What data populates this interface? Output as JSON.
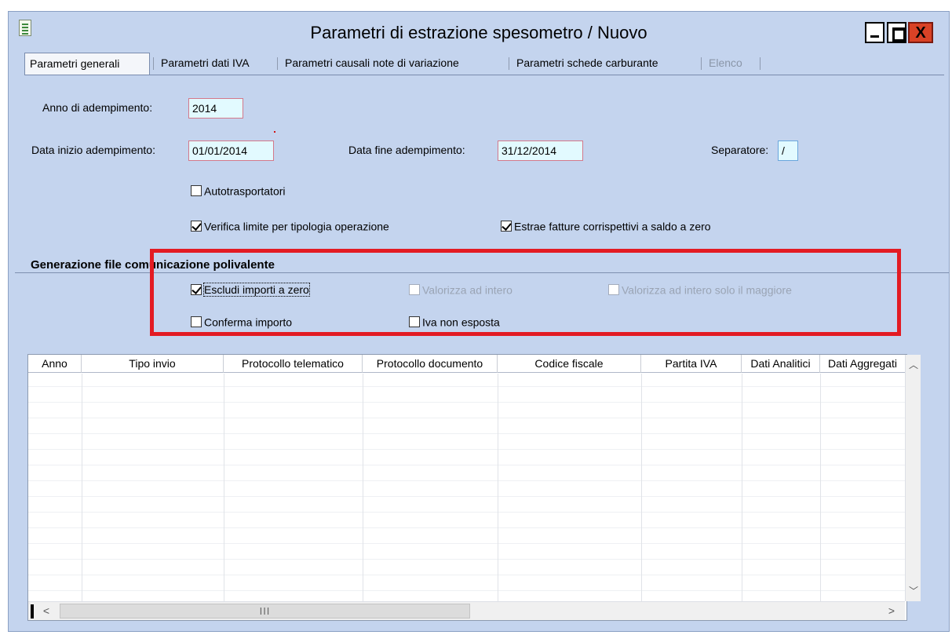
{
  "window": {
    "title": "Parametri di estrazione spesometro / Nuovo",
    "controls": {
      "minimize": "minimize",
      "maximize": "maximize",
      "close_glyph": "X"
    }
  },
  "tabs": [
    {
      "label": "Parametri generali",
      "active": true
    },
    {
      "label": "Parametri dati IVA"
    },
    {
      "label": "Parametri causali note di variazione"
    },
    {
      "label": "Parametri schede carburante"
    },
    {
      "label": "Elenco",
      "disabled": true
    }
  ],
  "form": {
    "anno_label": "Anno di adempimento:",
    "anno_value": "2014",
    "data_inizio_label": "Data inizio adempimento:",
    "data_inizio_value": "01/01/2014",
    "data_fine_label": "Data fine adempimento:",
    "data_fine_value": "31/12/2014",
    "separatore_label": "Separatore:",
    "separatore_value": "/"
  },
  "checks": {
    "autotrasportatori": {
      "label": "Autotrasportatori",
      "checked": false
    },
    "verifica_limite": {
      "label": "Verifica limite per tipologia operazione",
      "checked": true
    },
    "estrae_fatture": {
      "label": "Estrae fatture corrispettivi a saldo a zero",
      "checked": true
    }
  },
  "section": {
    "title": "Generazione file comunicazione polivalente",
    "checks": {
      "escludi": {
        "label": "Escludi importi a zero",
        "checked": true
      },
      "valorizza": {
        "label": "Valorizza ad intero",
        "checked": false,
        "disabled": true
      },
      "valorizza_maggiore": {
        "label": "Valorizza ad intero solo il maggiore",
        "checked": false,
        "disabled": true
      },
      "conferma": {
        "label": "Conferma importo",
        "checked": false
      },
      "iva": {
        "label": "Iva non esposta",
        "checked": false
      }
    }
  },
  "grid": {
    "columns": [
      "Anno",
      "Tipo invio",
      "Protocollo telematico",
      "Protocollo documento",
      "Codice fiscale",
      "Partita IVA",
      "Dati Analitici",
      "Dati Aggregati"
    ],
    "rows": [],
    "scroll": {
      "up": "︿",
      "down": "﹀",
      "left": "<",
      "right": ">",
      "grip": "III"
    }
  },
  "colors": {
    "window_bg": "#c4d4ee",
    "highlight": "#e31b23",
    "field_bg": "#e2faff"
  }
}
